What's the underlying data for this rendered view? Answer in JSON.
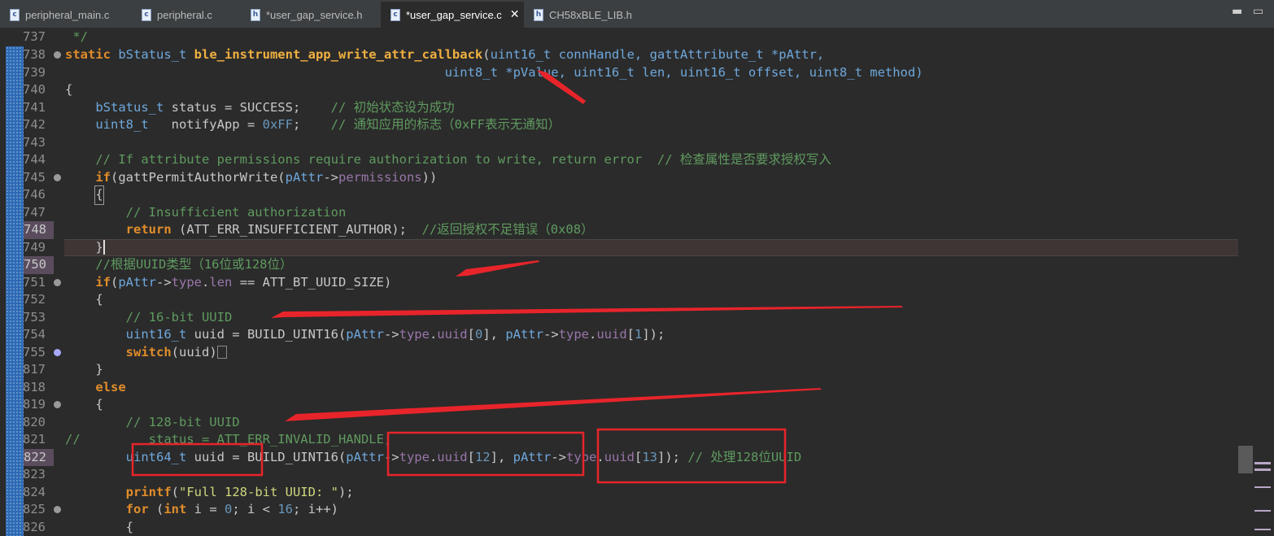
{
  "tabs": [
    {
      "label": "peripheral_main.c",
      "icon": "c"
    },
    {
      "label": "peripheral.c",
      "icon": "c"
    },
    {
      "label": "*user_gap_service.h",
      "icon": "h"
    },
    {
      "label": "*user_gap_service.c",
      "icon": "c",
      "active": true
    },
    {
      "label": "CH58xBLE_LIB.h",
      "icon": "h"
    }
  ],
  "window_controls": {
    "minimize": "▬",
    "maximize": "▭"
  },
  "lines": [
    {
      "n": "737"
    },
    {
      "n": "738"
    },
    {
      "n": "739"
    },
    {
      "n": "740"
    },
    {
      "n": "741"
    },
    {
      "n": "742"
    },
    {
      "n": "743"
    },
    {
      "n": "744"
    },
    {
      "n": "745"
    },
    {
      "n": "746"
    },
    {
      "n": "747"
    },
    {
      "n": "748"
    },
    {
      "n": "749"
    },
    {
      "n": "750"
    },
    {
      "n": "751"
    },
    {
      "n": "752"
    },
    {
      "n": "753"
    },
    {
      "n": "754"
    },
    {
      "n": "755"
    },
    {
      "n": "817"
    },
    {
      "n": "818"
    },
    {
      "n": "819"
    },
    {
      "n": "820"
    },
    {
      "n": "821"
    },
    {
      "n": "822"
    },
    {
      "n": "823"
    },
    {
      "n": "824"
    },
    {
      "n": "825"
    },
    {
      "n": "826"
    }
  ],
  "code": {
    "l737": " */",
    "l738_kw": "static ",
    "l738_ty": "bStatus_t ",
    "l738_fn": "ble_instrument_app_write_attr_callback",
    "l738_a": "(",
    "l738_t1": "uint16_t ",
    "l738_p1": "connHandle, ",
    "l738_t2": "gattAttribute_t ",
    "l738_p2": "*pAttr,",
    "l739_pad": "                                                  ",
    "l739_t1": "uint8_t ",
    "l739_p1": "*pValue, ",
    "l739_t2": "uint16_t ",
    "l739_p2": "len, ",
    "l739_t3": "uint16_t ",
    "l739_p3": "offset, ",
    "l739_t4": "uint8_t ",
    "l739_p4": "method)",
    "l740": "{",
    "l741_ty": "    bStatus_t ",
    "l741_a": "status = SUCCESS;    ",
    "l741_cm": "// 初始状态设为成功",
    "l742_ty": "    uint8_t ",
    "l742_a": "  notifyApp = ",
    "l742_nu": "0xFF",
    "l742_b": ";    ",
    "l742_cm": "// 通知应用的标志（0xFF表示无通知）",
    "l744_cm": "    // If attribute permissions require authorization to write, return error  // 检查属性是否要求授权写入",
    "l745_kw": "    if",
    "l745_a": "(gattPermitAuthorWrite(",
    "l745_ty": "pAttr",
    "l745_b": "->",
    "l745_f": "permissions",
    "l745_c": "))",
    "l746_pad": "    ",
    "l746_brace": "{",
    "l747_cm": "        // Insufficient authorization",
    "l748_kw": "        return ",
    "l748_a": "(ATT_ERR_INSUFFICIENT_AUTHOR);  ",
    "l748_cm": "//返回授权不足错误（0x08）",
    "l749_pad": "    ",
    "l749_brace": "}",
    "l750_cm": "    //根据UUID类型（16位或128位）",
    "l751_kw": "    if",
    "l751_a": "(",
    "l751_ty": "pAttr",
    "l751_b": "->",
    "l751_f": "type",
    "l751_c": ".",
    "l751_f2": "len",
    "l751_d": " == ATT_BT_UUID_SIZE)",
    "l752": "    {",
    "l753_cm": "        // 16-bit UUID",
    "l754_ty": "        uint16_t ",
    "l754_a": "uuid = BUILD_UINT16(",
    "l754_p1": "pAttr",
    "l754_b": "->",
    "l754_f1": "type",
    "l754_c": ".",
    "l754_f2": "uuid",
    "l754_d": "[",
    "l754_n1": "0",
    "l754_e": "], ",
    "l754_p2": "pAttr",
    "l754_g": "->",
    "l754_f3": "type",
    "l754_h": ".",
    "l754_f4": "uuid",
    "l754_i": "[",
    "l754_n2": "1",
    "l754_j": "]);",
    "l755_kw": "        switch",
    "l755_a": "(uuid)",
    "l817": "    }",
    "l818_kw": "    else",
    "l819": "    {",
    "l820_cm": "        // 128-bit UUID",
    "l821_cm": "//         status = ATT_ERR_INVALID_HANDLE;",
    "l822_ty": "        uint64_t ",
    "l822_a": "uuid = BUILD_UINT16(",
    "l822_p1": "pAttr",
    "l822_b": "->",
    "l822_f1": "type",
    "l822_c": ".",
    "l822_f2": "uuid",
    "l822_d": "[",
    "l822_n1": "12",
    "l822_e": "], ",
    "l822_p2": "pAttr",
    "l822_g": "->",
    "l822_f3": "type",
    "l822_h": ".",
    "l822_f4": "uuid",
    "l822_i": "[",
    "l822_n2": "13",
    "l822_j": "]); ",
    "l822_cm": "// 处理128位UUID",
    "l824_kw": "        printf",
    "l824_a": "(",
    "l824_st": "\"Full 128-bit UUID: \"",
    "l824_b": ");",
    "l825_kw": "        for ",
    "l825_a": "(",
    "l825_kw2": "int ",
    "l825_b": "i = ",
    "l825_n1": "0",
    "l825_c": "; i < ",
    "l825_n2": "16",
    "l825_d": "; i++)",
    "l826": "        {"
  },
  "colors": {
    "arrow": "#e8242b",
    "box": "#e8242b",
    "background": "#2b2b2b"
  }
}
